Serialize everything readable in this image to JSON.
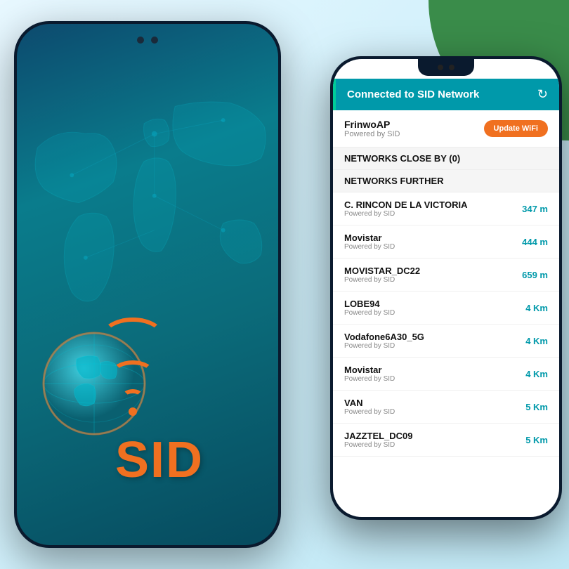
{
  "scene": {
    "green_shape_visible": true
  },
  "phone_back": {
    "brand": "SID",
    "wifi_arcs": 3
  },
  "phone_front": {
    "header": {
      "title": "Connected to SID Network",
      "refresh_icon": "refresh-icon"
    },
    "connected": {
      "name": "FrinwoAP",
      "sub": "Powered by SID",
      "button_label": "Update WiFi"
    },
    "sections": [
      {
        "label": "NETWORKS CLOSE BY (0)",
        "items": []
      },
      {
        "label": "NETWORKS FURTHER",
        "items": [
          {
            "name": "C. RINCON DE LA VICTORIA",
            "sub": "Powered by SID",
            "distance": "347 m"
          },
          {
            "name": "Movistar",
            "sub": "Powered by SID",
            "distance": "444 m"
          },
          {
            "name": "MOVISTAR_DC22",
            "sub": "Powered by SID",
            "distance": "659 m"
          },
          {
            "name": "LOBE94",
            "sub": "Powered by SID",
            "distance": "4 Km"
          },
          {
            "name": "Vodafone6A30_5G",
            "sub": "Powered by SID",
            "distance": "4 Km"
          },
          {
            "name": "Movistar",
            "sub": "Powered by SID",
            "distance": "4 Km"
          },
          {
            "name": "VAN",
            "sub": "Powered by SID",
            "distance": "5 Km"
          },
          {
            "name": "JAZZTEL_DC09",
            "sub": "Powered by SID",
            "distance": "5 Km"
          }
        ]
      }
    ]
  }
}
